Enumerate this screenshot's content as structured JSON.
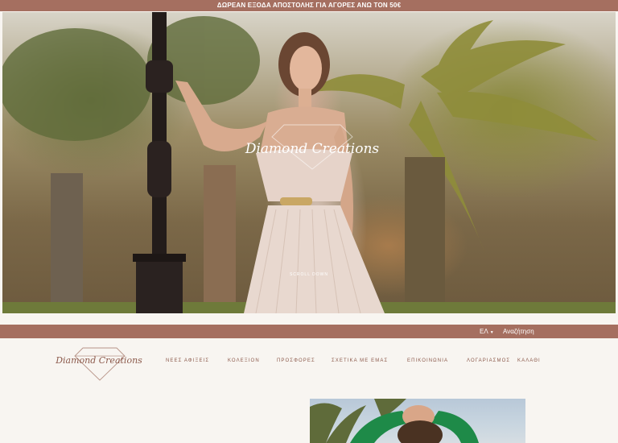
{
  "announcement": "ΔΩΡΕΑΝ ΕΞΟΔΑ ΑΠΟΣΤΟΛΗΣ ΓΙΑ ΑΓΟΡΕΣ ΑΝΩ ΤΟΝ 50€",
  "hero": {
    "logo_text": "Diamond Creations",
    "scroll_text": "SCROLL DOWN"
  },
  "utility": {
    "language": "ΕΛ",
    "search": "Αναζήτηση"
  },
  "brand": {
    "logo_text": "Diamond Creations"
  },
  "nav": [
    {
      "label": "ΝΕΕΣ ΑΦΙΞΕΙΣ"
    },
    {
      "label": "ΚΟΛΕΞΙΟΝ"
    },
    {
      "label": "ΠΡΟΣΦΟΡΕΣ"
    },
    {
      "label": "ΣΧΕΤΙΚΑ ΜΕ ΕΜΑΣ"
    },
    {
      "label": "ΕΠΙΚΟΙΝΩΝΙΑ"
    },
    {
      "label": "ΛΟΓΑΡΙΑΣΜΟΣ"
    },
    {
      "label": "ΚΑΛΑΘΙ"
    }
  ],
  "colors": {
    "accent": "#a56f60",
    "background": "#f8f5f1",
    "nav_text": "#8c5a4c"
  }
}
